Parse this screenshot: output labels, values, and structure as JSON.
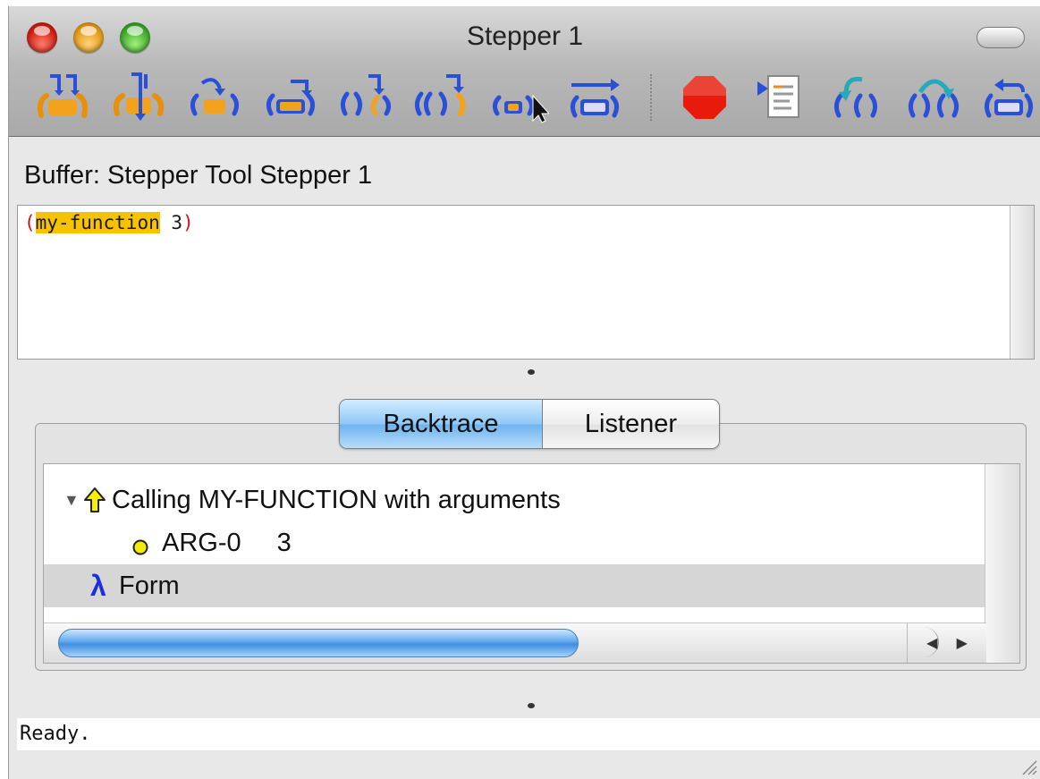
{
  "window": {
    "title": "Stepper 1"
  },
  "toolbar": {
    "buttons": [
      {
        "icon": "step-into-multiple-icon"
      },
      {
        "icon": "step-down-icon"
      },
      {
        "icon": "step-into-form-icon"
      },
      {
        "icon": "step-over-form-icon"
      },
      {
        "icon": "step-out-form-icon"
      },
      {
        "icon": "step-out-outer-form-icon"
      },
      {
        "icon": "step-to-cursor-icon"
      },
      {
        "icon": "step-to-end-icon"
      },
      {
        "icon": "stop-icon"
      },
      {
        "icon": "show-source-icon"
      },
      {
        "icon": "undo-step-icon"
      },
      {
        "icon": "restart-form-icon"
      },
      {
        "icon": "return-icon"
      }
    ]
  },
  "buffer": {
    "label": "Buffer: Stepper Tool Stepper 1",
    "code_open_paren": "(",
    "code_function": "my-function",
    "code_rest": " 3",
    "code_close_paren": ")"
  },
  "tabs": {
    "items": [
      "Backtrace",
      "Listener"
    ],
    "active": "Backtrace"
  },
  "backtrace": {
    "frame_label": "Calling MY-FUNCTION with arguments",
    "arg_name": "ARG-0",
    "arg_value": "3",
    "form_label": "Form"
  },
  "status": {
    "text": "Ready."
  },
  "colors": {
    "accent_blue": "#2a4fd8",
    "highlight": "#f7c202",
    "paren_red": "#d21414",
    "stop_red": "#e81a0c"
  }
}
